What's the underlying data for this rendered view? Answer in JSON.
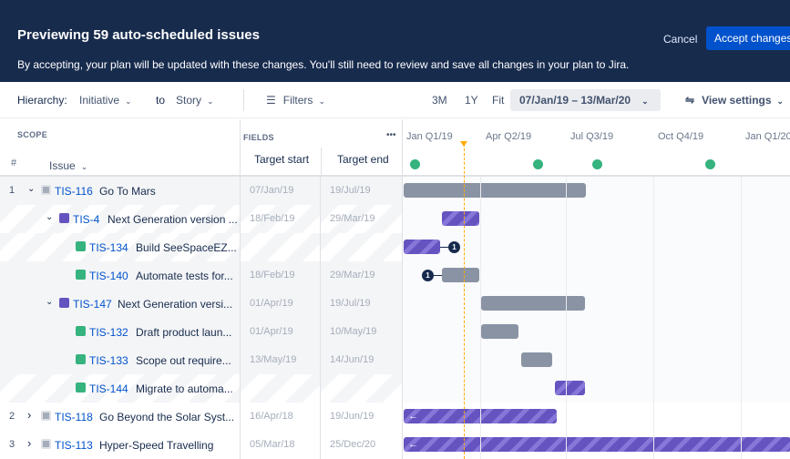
{
  "banner": {
    "title": "Previewing 59 auto-scheduled issues",
    "subtitle": "By accepting, your plan will be updated with these changes. You'll still need to review and save all changes in your plan to Jira.",
    "cancel": "Cancel",
    "accept": "Accept changes"
  },
  "toolbar": {
    "hierarchy_label": "Hierarchy:",
    "hierarchy_from": "Initiative",
    "to_label": "to",
    "hierarchy_to": "Story",
    "filters": "Filters",
    "zoom_3m": "3M",
    "zoom_1y": "1Y",
    "zoom_fit": "Fit",
    "date_range": "07/Jan/19 – 13/Mar/20",
    "view_settings": "View settings"
  },
  "header": {
    "scope": "SCOPE",
    "hash": "#",
    "issue": "Issue",
    "fields": "FIELDS",
    "more": "•••",
    "target_start": "Target start",
    "target_end": "Target end",
    "quarters": [
      "Jan Q1/19",
      "Apr Q2/19",
      "Jul Q3/19",
      "Oct Q4/19",
      "Jan Q1/20"
    ]
  },
  "rows": [
    {
      "num": "1",
      "expander": "⌄",
      "type": "initiative",
      "key": "TIS-116",
      "title": "Go To Mars",
      "start": "07/Jan/19",
      "end": "19/Jul/19"
    },
    {
      "num": "",
      "expander": "⌄",
      "type": "epic",
      "key": "TIS-4",
      "title": "Next Generation version ...",
      "start": "18/Feb/19",
      "end": "29/Mar/19"
    },
    {
      "num": "",
      "expander": "",
      "type": "story",
      "key": "TIS-134",
      "title": "Build SeeSpaceEZ...",
      "start": "",
      "end": ""
    },
    {
      "num": "",
      "expander": "",
      "type": "story",
      "key": "TIS-140",
      "title": "Automate tests for...",
      "start": "18/Feb/19",
      "end": "29/Mar/19"
    },
    {
      "num": "",
      "expander": "⌄",
      "type": "epic",
      "key": "TIS-147",
      "title": "Next Generation versi...",
      "start": "01/Apr/19",
      "end": "19/Jul/19"
    },
    {
      "num": "",
      "expander": "",
      "type": "story",
      "key": "TIS-132",
      "title": "Draft product laun...",
      "start": "01/Apr/19",
      "end": "10/May/19"
    },
    {
      "num": "",
      "expander": "",
      "type": "story",
      "key": "TIS-133",
      "title": "Scope out require...",
      "start": "13/May/19",
      "end": "14/Jun/19"
    },
    {
      "num": "",
      "expander": "",
      "type": "story",
      "key": "TIS-144",
      "title": "Migrate to automa...",
      "start": "",
      "end": ""
    },
    {
      "num": "2",
      "expander": "›",
      "type": "initiative",
      "key": "TIS-118",
      "title": "Go Beyond the Solar Syst...",
      "start": "16/Apr/18",
      "end": "19/Jun/19"
    },
    {
      "num": "3",
      "expander": "›",
      "type": "initiative",
      "key": "TIS-113",
      "title": "Hyper-Speed Travelling",
      "start": "05/Mar/18",
      "end": "25/Dec/20"
    }
  ],
  "deps": [
    "1",
    "1"
  ],
  "colors": {
    "banner": "#172b4d",
    "accent": "#0052cc",
    "epic": "#6554c0",
    "story": "#36b37e",
    "today": "#ffab00"
  }
}
